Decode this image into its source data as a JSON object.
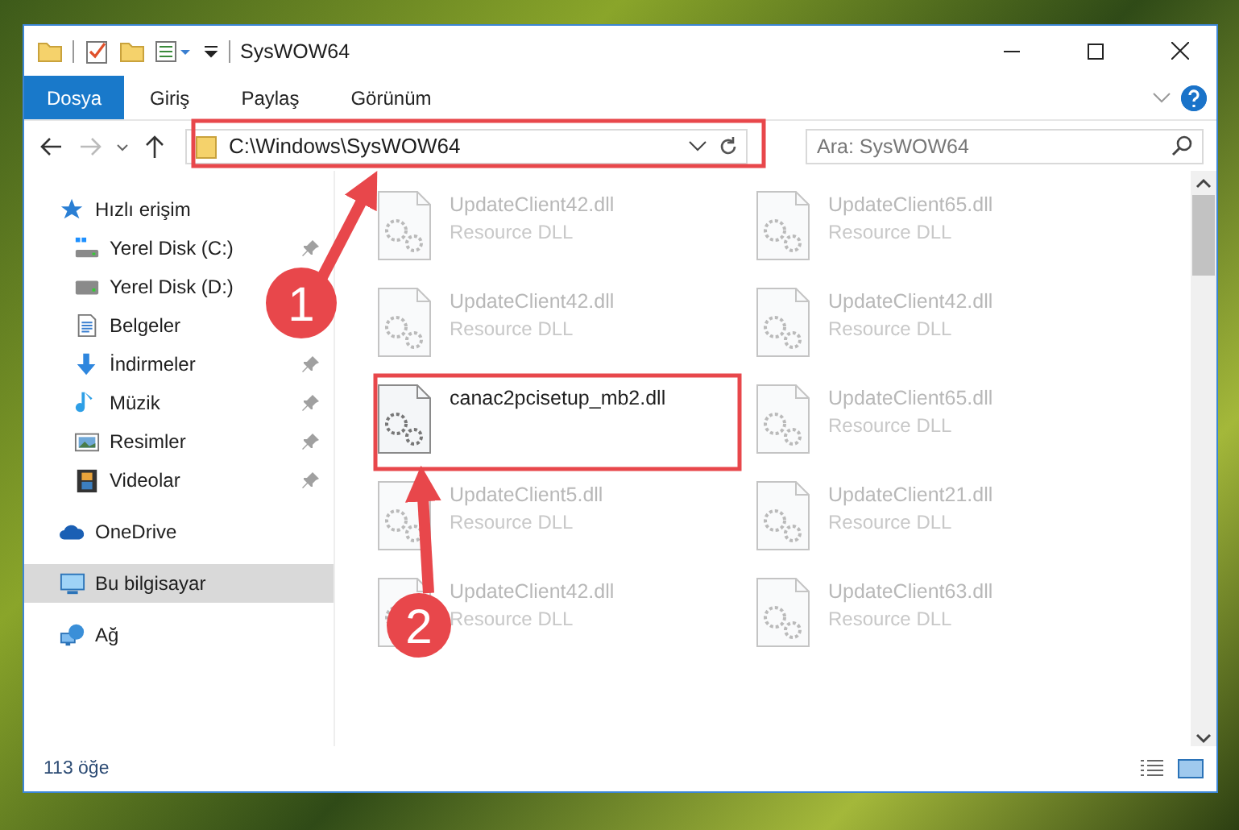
{
  "window": {
    "title": "SysWOW64"
  },
  "ribbon_tabs": [
    {
      "label": "Dosya",
      "selected": true
    },
    {
      "label": "Giriş",
      "selected": false
    },
    {
      "label": "Paylaş",
      "selected": false
    },
    {
      "label": "Görünüm",
      "selected": false
    }
  ],
  "address": {
    "value": "C:\\Windows\\SysWOW64"
  },
  "search": {
    "placeholder": "Ara: SysWOW64"
  },
  "sidebar": {
    "items": [
      {
        "label": "Hızlı erişim",
        "selected": false,
        "children": [
          {
            "label": "Yerel Disk (C:)",
            "pinned": true,
            "selected": false
          },
          {
            "label": "Yerel Disk (D:)",
            "selected": false
          },
          {
            "label": "Belgeler",
            "selected": false
          },
          {
            "label": "İndirmeler",
            "pinned": true,
            "selected": false
          },
          {
            "label": "Müzik",
            "pinned": true,
            "selected": false
          },
          {
            "label": "Resimler",
            "pinned": true,
            "selected": false
          },
          {
            "label": "Videolar",
            "pinned": true,
            "selected": false
          }
        ]
      },
      {
        "label": "OneDrive",
        "selected": false
      },
      {
        "label": "Bu bilgisayar",
        "selected": true
      },
      {
        "label": "Ağ",
        "selected": false
      }
    ]
  },
  "files": [
    {
      "name": "UpdateClient42.dll",
      "type": "Resource DLL",
      "dimmed": true
    },
    {
      "name": "UpdateClient65.dll",
      "type": "Resource DLL",
      "dimmed": true
    },
    {
      "name": "UpdateClient42.dll",
      "type": "Resource DLL",
      "dimmed": true
    },
    {
      "name": "UpdateClient42.dll",
      "type": "Resource DLL",
      "dimmed": true
    },
    {
      "name": "canac2pcisetup_mb2.dll",
      "dimmed": false
    },
    {
      "name": "UpdateClient65.dll",
      "type": "Resource DLL",
      "dimmed": true
    },
    {
      "name": "UpdateClient5.dll",
      "type": "Resource DLL",
      "dimmed": true
    },
    {
      "name": "UpdateClient21.dll",
      "type": "Resource DLL",
      "dimmed": true
    },
    {
      "name": "UpdateClient42.dll",
      "type": "Resource DLL",
      "dimmed": true
    },
    {
      "name": "UpdateClient63.dll",
      "type": "Resource DLL",
      "dimmed": true
    }
  ],
  "status_bar": {
    "item_count": "113 öğe"
  },
  "annotations": [
    {
      "number": "1"
    },
    {
      "number": "2"
    }
  ]
}
